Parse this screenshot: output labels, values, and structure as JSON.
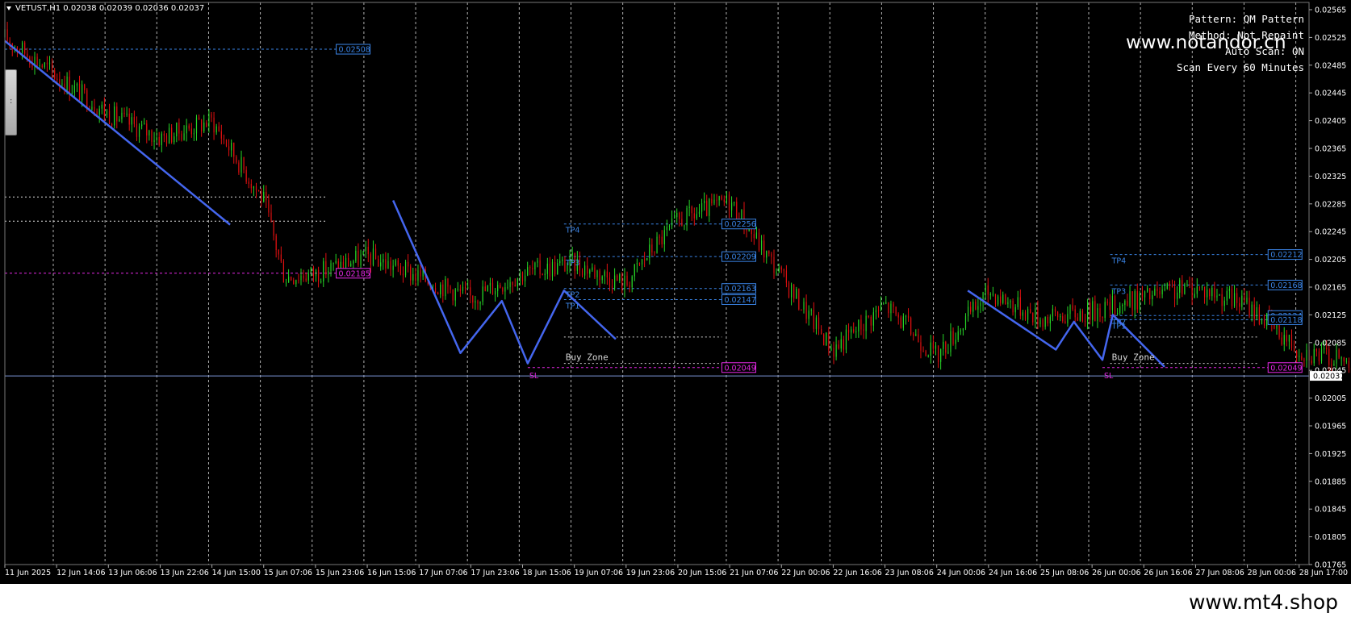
{
  "header": {
    "symbol_line": "VETUST,H1  0.02038 0.02039 0.02036 0.02037"
  },
  "info_panel": {
    "pattern": "Pattern: QM Pattern",
    "method": "Method: Not Repaint",
    "auto_scan": "Auto Scan: ON",
    "scan_every": "Scan Every 60 Minutes"
  },
  "watermarks": {
    "top": "www.notandor.cn",
    "bottom": "www.mt4.shop"
  },
  "scroll_handle_glyph": ":",
  "colors": {
    "background": "#000000",
    "bull": "#27d627",
    "bear": "#e01010",
    "zigzag": "#4466ee",
    "level_blue": "#3a84e6",
    "level_magenta": "#e628e6",
    "grid": "#cfcfcf",
    "current_price_line": "#7d97d8"
  },
  "chart_data": {
    "type": "candlestick",
    "symbol": "VETUST",
    "timeframe": "H1",
    "ohlc_current": {
      "open": 0.02038,
      "high": 0.02039,
      "low": 0.02036,
      "close": 0.02037
    },
    "ylim": [
      0.01765,
      0.02565
    ],
    "y_ticks": [
      "0.02565",
      "0.02525",
      "0.02485",
      "0.02445",
      "0.02405",
      "0.02365",
      "0.02325",
      "0.02285",
      "0.02245",
      "0.02205",
      "0.02165",
      "0.02125",
      "0.02085",
      "0.02045",
      "0.02005",
      "0.01965",
      "0.01925",
      "0.01885",
      "0.01845",
      "0.01805",
      "0.01765"
    ],
    "x_ticks": [
      "11 Jun 2025",
      "12 Jun 14:06",
      "13 Jun 06:06",
      "13 Jun 22:06",
      "14 Jun 15:00",
      "15 Jun 07:06",
      "15 Jun 23:06",
      "16 Jun 15:06",
      "17 Jun 07:06",
      "17 Jun 23:06",
      "18 Jun 15:06",
      "19 Jun 07:06",
      "19 Jun 23:06",
      "20 Jun 15:06",
      "21 Jun 07:06",
      "22 Jun 00:06",
      "22 Jun 16:06",
      "23 Jun 08:06",
      "24 Jun 00:06",
      "24 Jun 16:06",
      "25 Jun 08:06",
      "26 Jun 00:06",
      "26 Jun 16:06",
      "27 Jun 08:06",
      "28 Jun 00:06",
      "28 Jun 17:00"
    ],
    "price_path": [
      [
        0,
        0.02525
      ],
      [
        1,
        0.0247
      ],
      [
        2,
        0.02415
      ],
      [
        3,
        0.0238
      ],
      [
        4,
        0.02405
      ],
      [
        5,
        0.0229
      ],
      [
        5.4,
        0.0218
      ],
      [
        6,
        0.02185
      ],
      [
        7,
        0.0221
      ],
      [
        8,
        0.0218
      ],
      [
        9,
        0.0215
      ],
      [
        10,
        0.02185
      ],
      [
        11,
        0.022
      ],
      [
        12,
        0.0217
      ],
      [
        12.5,
        0.0222
      ],
      [
        13,
        0.0226
      ],
      [
        14,
        0.0229
      ],
      [
        15,
        0.0218
      ],
      [
        16,
        0.02075
      ],
      [
        17,
        0.0214
      ],
      [
        18,
        0.02065
      ],
      [
        19,
        0.0216
      ],
      [
        20,
        0.0212
      ],
      [
        21,
        0.0213
      ],
      [
        22,
        0.0215
      ],
      [
        23,
        0.02165
      ],
      [
        24,
        0.0214
      ],
      [
        25,
        0.02075
      ],
      [
        26,
        0.02055
      ],
      [
        27,
        0.0209
      ],
      [
        28,
        0.0204
      ],
      [
        29,
        0.01965
      ],
      [
        30,
        0.0193
      ],
      [
        31,
        0.01925
      ],
      [
        31.5,
        0.0186
      ],
      [
        32,
        0.01835
      ],
      [
        33,
        0.01905
      ],
      [
        34,
        0.01935
      ],
      [
        35,
        0.0195
      ],
      [
        35.5,
        0.0206
      ],
      [
        36,
        0.02155
      ],
      [
        37,
        0.0213
      ],
      [
        38,
        0.02115
      ],
      [
        39,
        0.021
      ],
      [
        40,
        0.0212
      ],
      [
        41,
        0.02105
      ],
      [
        42,
        0.0207
      ],
      [
        42.2,
        0.0214
      ],
      [
        43,
        0.0208
      ],
      [
        44,
        0.02055
      ],
      [
        44.5,
        0.02015
      ],
      [
        45,
        0.0201
      ],
      [
        46,
        0.02005
      ],
      [
        47,
        0.01995
      ],
      [
        48,
        0.0201
      ],
      [
        49,
        0.0202
      ],
      [
        50,
        0.02037
      ]
    ],
    "zigzags": [
      [
        [
          0,
          0.0252
        ],
        [
          4.35,
          0.02255
        ]
      ],
      [
        [
          7.5,
          0.0229
        ],
        [
          8.8,
          0.0207
        ],
        [
          9.6,
          0.02145
        ],
        [
          10.1,
          0.02055
        ],
        [
          10.8,
          0.0216
        ],
        [
          11.8,
          0.0209
        ]
      ],
      [
        [
          18.6,
          0.0216
        ],
        [
          20.3,
          0.02075
        ],
        [
          20.65,
          0.02115
        ],
        [
          21.2,
          0.0206
        ],
        [
          21.4,
          0.02125
        ],
        [
          22.4,
          0.0205
        ]
      ]
    ],
    "levels": [
      {
        "price": 0.02508,
        "label": "0.02508",
        "color": "blue",
        "x_from": 0,
        "x_to": 6.4
      },
      {
        "price": 0.02185,
        "label": "0.02185",
        "color": "magenta",
        "x_from": 0,
        "x_to": 6.4
      },
      {
        "price": 0.02256,
        "label": "0.02256",
        "tag": "TP4",
        "color": "blue",
        "x_from": 10.8,
        "x_to": 13.85
      },
      {
        "price": 0.02209,
        "label": "0.02209",
        "tag": "TP3",
        "color": "blue",
        "x_from": 10.8,
        "x_to": 13.85
      },
      {
        "price": 0.02163,
        "label": "0.02163",
        "tag": "TP2",
        "color": "blue",
        "x_from": 10.8,
        "x_to": 13.85
      },
      {
        "price": 0.02147,
        "label": "0.02147",
        "tag": "TP1",
        "color": "blue",
        "x_from": 10.8,
        "x_to": 13.85
      },
      {
        "price": 0.02049,
        "label": "0.02049",
        "tag": "SL",
        "color": "magenta",
        "x_from": 10.1,
        "x_to": 13.85
      },
      {
        "price": 0.02212,
        "label": "0.02212",
        "tag": "TP4",
        "color": "blue",
        "x_from": 21.35,
        "x_to": 24.4
      },
      {
        "price": 0.02168,
        "label": "0.02168",
        "tag": "TP3",
        "color": "blue",
        "x_from": 21.35,
        "x_to": 24.4
      },
      {
        "price": 0.02124,
        "label": "0.02124",
        "tag": "TP2",
        "color": "blue",
        "x_from": 21.35,
        "x_to": 24.4
      },
      {
        "price": 0.02118,
        "label": "0.02118",
        "tag": "TP1",
        "color": "blue",
        "x_from": 21.35,
        "x_to": 24.4
      },
      {
        "price": 0.02049,
        "label": "0.02049",
        "tag": "SL",
        "color": "magenta",
        "x_from": 21.2,
        "x_to": 24.4
      }
    ],
    "buy_zones": [
      {
        "label": "Buy Zone",
        "top": 0.02093,
        "bottom": 0.02055,
        "x_from": 10.8,
        "x_to": 13.85
      },
      {
        "label": "Buy Zone",
        "top": 0.02093,
        "bottom": 0.02055,
        "x_from": 21.35,
        "x_to": 24.2
      }
    ],
    "neckline_levels": [
      {
        "price": 0.02295,
        "x_from": 0,
        "x_to": 6.2
      },
      {
        "price": 0.0226,
        "x_from": 0,
        "x_to": 6.2
      }
    ],
    "current_price": {
      "value": 0.02037,
      "label": "0.02037"
    },
    "grid": true
  }
}
